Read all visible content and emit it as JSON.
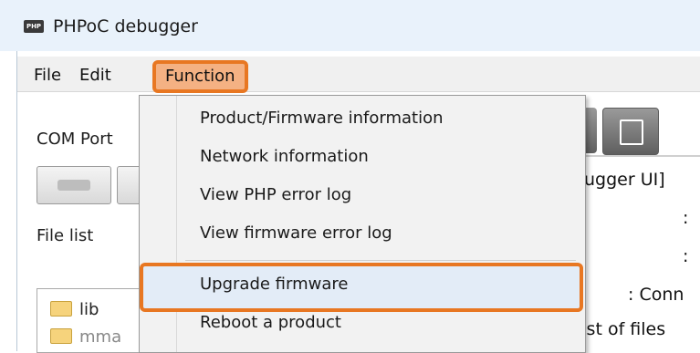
{
  "window": {
    "title": "PHPoC debugger",
    "app_icon_label": "PHP"
  },
  "menubar": {
    "file_label": "File",
    "edit_label": "Edit",
    "function_label": "Function"
  },
  "left_panel": {
    "com_port_label": "COM Port",
    "file_list_label": "File list",
    "tree_items": [
      "lib",
      "mma"
    ]
  },
  "right_panel": {
    "debugger_text": "ugger UI]",
    "colon1_text": ":",
    "colon2_text": ":",
    "conn_text": ": Conn",
    "list_text": "list of files"
  },
  "function_menu": {
    "items": [
      "Product/Firmware information",
      "Network information",
      "View PHP error log",
      "View firmware error log",
      "Upgrade firmware",
      "Reboot a product"
    ],
    "highlighted_index": 4
  },
  "colors": {
    "accent": "#e87722",
    "menu_highlight": "#f4b183",
    "titlebar": "#e9f2fb"
  }
}
